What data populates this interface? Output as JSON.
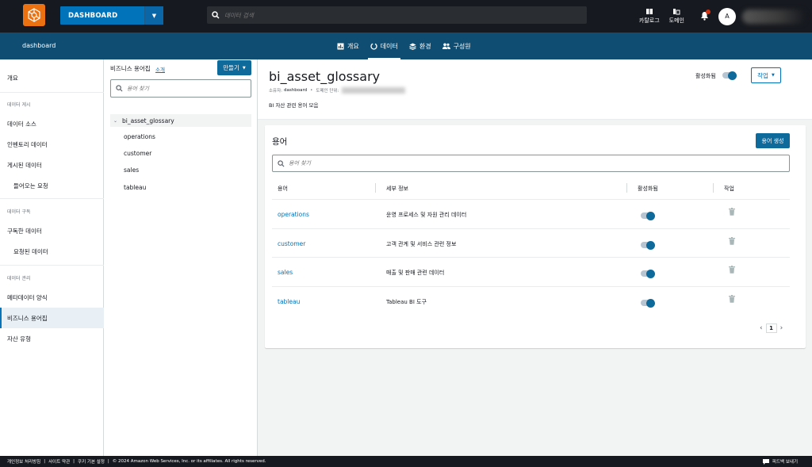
{
  "topbar": {
    "dashboard_label": "DASHBOARD",
    "search_placeholder": "데이터 검색",
    "catalog_label": "카탈로그",
    "domain_label": "도메인",
    "avatar_initial": "A"
  },
  "subbar": {
    "breadcrumb": "dashboard",
    "tabs": [
      {
        "label": "개요",
        "icon": "overview-icon"
      },
      {
        "label": "데이터",
        "icon": "data-icon",
        "active": true
      },
      {
        "label": "환경",
        "icon": "environment-icon"
      },
      {
        "label": "구성원",
        "icon": "members-icon"
      }
    ]
  },
  "nav": {
    "overview": "개요",
    "section_publish": "데이터 게시",
    "data_sources": "데이터 소스",
    "inventory_data": "인벤토리 데이터",
    "published_data": "게시된 데이터",
    "incoming_requests": "들어오는 요청",
    "section_subscribe": "데이터 구독",
    "subscribed_data": "구독한 데이터",
    "requested_data": "요청된 데이터",
    "section_manage": "데이터 관리",
    "metadata_forms": "메타데이터 양식",
    "business_glossary": "비즈니스 용어집",
    "asset_types": "자산 유형"
  },
  "tree": {
    "title": "비즈니스 용어집",
    "intro_link": "소개",
    "make_button": "만들기",
    "search_placeholder": "용어 찾기",
    "root": "bi_asset_glossary",
    "children": [
      "operations",
      "customer",
      "sales",
      "tableau"
    ]
  },
  "glossary": {
    "title": "bi_asset_glossary",
    "owner_label": "소유자:",
    "owner_value": "dashboard",
    "domain_unit_label": "도메인 단위:",
    "description": "BI 자산 관련 용어 모음",
    "active_label": "활성화됨",
    "action_button": "작업"
  },
  "terms": {
    "title": "용어",
    "create_button": "용어 생성",
    "search_placeholder": "용어 찾기",
    "columns": [
      "용어",
      "세부 정보",
      "활성화됨",
      "작업"
    ],
    "rows": [
      {
        "name": "operations",
        "desc": "운영 프로세스 및 자원 관리 데이터",
        "active": true
      },
      {
        "name": "customer",
        "desc": "고객 관계 및 서비스 관련 정보",
        "active": true
      },
      {
        "name": "sales",
        "desc": "매출 및 판매 관련 데이터",
        "active": true
      },
      {
        "name": "tableau",
        "desc": "Tableau BI 도구",
        "active": true
      }
    ],
    "page": "1"
  },
  "footer": {
    "privacy": "개인정보 처리방침",
    "site_terms": "사이트 약관",
    "cookie": "쿠키 기본 설정",
    "copyright": "© 2024 Amazon Web Services, Inc. or its affiliates. All rights reserved.",
    "feedback": "피드백 보내기"
  },
  "colors": {
    "topbar": "#16191f",
    "subbar": "#0f4e72",
    "accent": "#0073bb",
    "brand_orange": "#ec7211"
  }
}
